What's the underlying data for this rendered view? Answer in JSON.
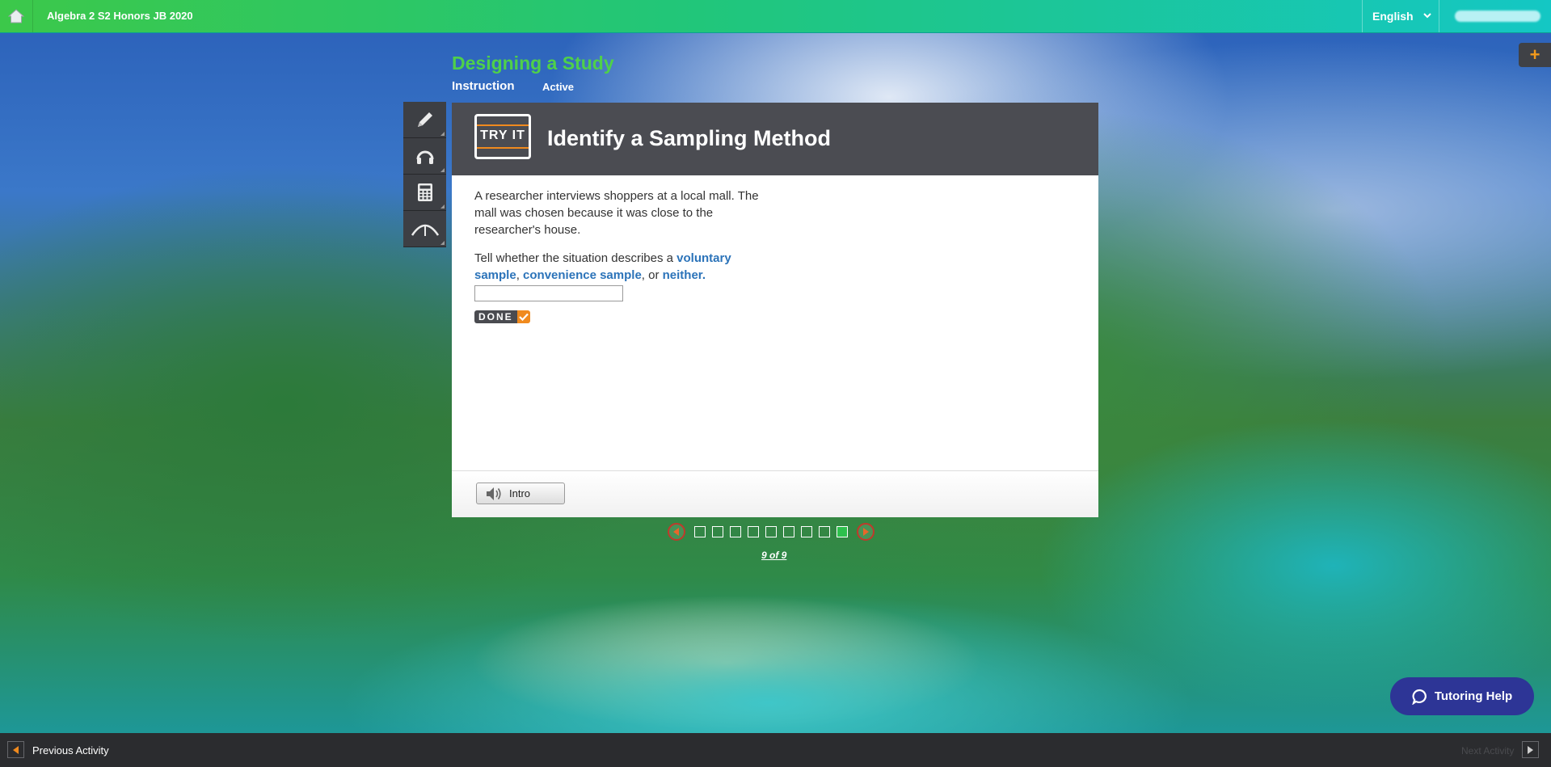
{
  "topbar": {
    "course_title": "Algebra 2 S2 Honors JB 2020",
    "language": "English",
    "home_icon": "home-icon",
    "plus_icon": "plus-icon"
  },
  "lesson": {
    "title": "Designing a Study",
    "section": "Instruction",
    "status": "Active"
  },
  "tools": [
    {
      "icon": "pencil-icon"
    },
    {
      "icon": "headphones-icon"
    },
    {
      "icon": "calculator-icon"
    },
    {
      "icon": "graph-icon"
    }
  ],
  "panel": {
    "badge": "TRY IT",
    "title": "Identify a Sampling Method",
    "prompt": "A researcher interviews shoppers at a local mall. The mall was chosen because it was close to the researcher's house.",
    "question_prefix": "Tell whether the situation describes a ",
    "option1": "voluntary sample",
    "sep1": ", ",
    "option2": "convenience sample",
    "sep2": ", or ",
    "option3": "neither",
    "end": ".",
    "answer_value": "",
    "done_label": "DONE",
    "intro_label": "Intro"
  },
  "pager": {
    "total": 9,
    "current": 9,
    "label": "9 of 9"
  },
  "tutoring": {
    "label": "Tutoring Help"
  },
  "bottombar": {
    "prev_label": "Previous Activity",
    "next_label": "Next Activity"
  },
  "colors": {
    "accent_green": "#4fd04a",
    "keyword_blue": "#2b73b9",
    "orange": "#f08a1e",
    "tutor_navy": "#2d3596"
  }
}
